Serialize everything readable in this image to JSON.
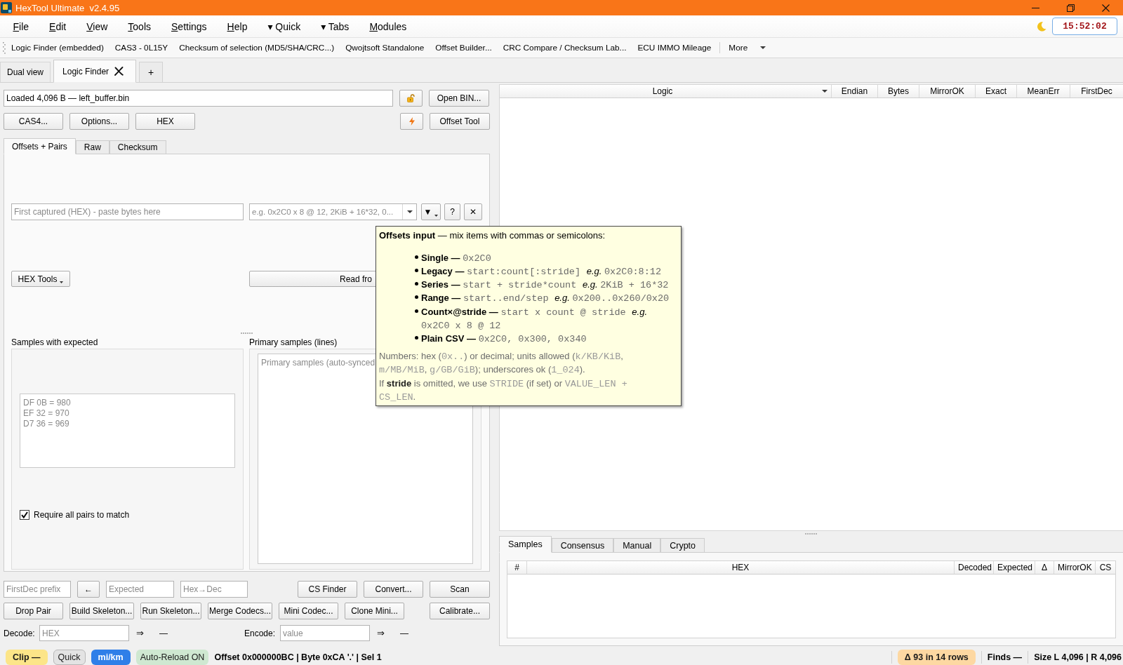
{
  "window": {
    "title": "HexTool Ultimate  v2.4.95"
  },
  "menu": [
    {
      "label": "File",
      "mnemonic": true
    },
    {
      "label": "Edit",
      "mnemonic": true
    },
    {
      "label": "View",
      "mnemonic": true
    },
    {
      "label": "Tools",
      "mnemonic": true
    },
    {
      "label": "Settings",
      "mnemonic": true
    },
    {
      "label": "Help",
      "mnemonic": true
    },
    {
      "label": "▾ Quick",
      "mnemonic": false
    },
    {
      "label": "▾ Tabs",
      "mnemonic": false
    },
    {
      "label": "Modules",
      "mnemonic": true
    }
  ],
  "clock": "15:52:02",
  "toolbar": {
    "items": [
      "Logic Finder (embedded)",
      "CAS3 - 0L15Y",
      "Checksum of selection (MD5/SHA/CRC...)",
      "Qwojtsoft Standalone",
      "Offset Builder...",
      "CRC Compare / Checksum Lab...",
      "ECU IMMO Mileage"
    ],
    "more": "More"
  },
  "doc_tabs": [
    {
      "label": "Dual view",
      "selected": false,
      "closable": false
    },
    {
      "label": "Logic Finder",
      "selected": true,
      "closable": true
    }
  ],
  "new_tab": "+",
  "logic_finder": {
    "file_field": {
      "value": "Loaded 4,096 B — left_buffer.bin"
    },
    "open_button": "Open BIN...",
    "tool_buttons": [
      "CAS4...",
      "Options...",
      "HEX"
    ],
    "offset_tool_button": "Offset Tool",
    "tabs": [
      {
        "label": "Offsets + Pairs",
        "selected": true
      },
      {
        "label": "Raw",
        "selected": false
      },
      {
        "label": "Checksum",
        "selected": false
      }
    ],
    "captured_field": {
      "placeholder": "First captured (HEX) - paste bytes here"
    },
    "offsets_combo": {
      "placeholder": "e.g. 0x2C0 x 8 @ 12, 2KiB + 16*32, 0..."
    },
    "offset_buttons": [
      {
        "label": "▼",
        "kind": "menu"
      },
      {
        "label": "?",
        "kind": "plain"
      },
      {
        "label": "✕",
        "kind": "plain"
      }
    ],
    "hex_tools_button": {
      "label": "HEX Tools",
      "kind": "menu"
    },
    "read_button": "Read fro",
    "samples_label": "Samples with expected",
    "primary_label": "Primary samples (lines)",
    "samples_box": {
      "placeholder": "DF 0B = 980\nEF 32 = 970\nD7 36 = 969"
    },
    "require_all_pairs": {
      "label": "Require all pairs to match",
      "checked": true
    },
    "primary_box": {
      "placeholder": "Primary samples (auto-synced"
    },
    "lookup_row": {
      "left": [
        {
          "kind": "field",
          "placeholder": "FirstDec prefix"
        },
        {
          "kind": "button",
          "label": "←"
        },
        {
          "kind": "field",
          "placeholder": "Expected"
        },
        {
          "kind": "field",
          "placeholder": "Hex→Dec"
        }
      ],
      "right": [
        "CS Finder",
        "Convert...",
        "Scan"
      ]
    },
    "action_row": {
      "left": [
        "Drop Pair",
        "Build Skeleton...",
        "Run Skeleton...",
        "Merge Codecs...",
        "Mini Codec...",
        "Clone Mini..."
      ],
      "right": [
        "Calibrate..."
      ]
    },
    "codec_row": [
      {
        "label": "Decode:",
        "placeholder": "HEX",
        "arrow": "⇒",
        "result": "—"
      },
      {
        "label": "Encode:",
        "placeholder": "value",
        "arrow": "⇒",
        "result": "—"
      }
    ]
  },
  "results_table": {
    "columns": [
      {
        "label": "Logic",
        "sorted": true
      },
      {
        "label": "Endian",
        "sorted": false
      },
      {
        "label": "Bytes",
        "sorted": false
      },
      {
        "label": "MirrorOK",
        "sorted": false
      },
      {
        "label": "Exact",
        "sorted": false
      },
      {
        "label": "MeanErr",
        "sorted": false
      },
      {
        "label": "FirstDec",
        "sorted": false
      }
    ]
  },
  "lower_tabs": [
    {
      "label": "Samples",
      "selected": true
    },
    {
      "label": "Consensus",
      "selected": false
    },
    {
      "label": "Manual",
      "selected": false
    },
    {
      "label": "Crypto",
      "selected": false
    }
  ],
  "samples_table": {
    "columns": [
      "#",
      "HEX",
      "Decoded",
      "Expected",
      "Δ",
      "MirrorOK",
      "CS"
    ]
  },
  "tooltip": {
    "title": "**Offsets input** — mix items with commas or semicolons:",
    "items": [
      {
        "label": "Single —",
        "syntax": "0x2C0"
      },
      {
        "label": "Legacy —",
        "syntax": "start:count[:stride]",
        "eg": "e.g.",
        "example": "0x2C0:8:12"
      },
      {
        "label": "Series —",
        "syntax": "start + stride*count",
        "eg": "e.g.",
        "example": "2KiB + 16*32"
      },
      {
        "label": "Range —",
        "syntax": "start..end/step",
        "eg": "e.g.",
        "example": "0x200..0x260/0x20"
      },
      {
        "label": "Count×@stride —",
        "syntax": "start x count @ stride",
        "eg": "e.g.",
        "example": "0x2C0 x 8 @ 12"
      },
      {
        "label": "Plain CSV —",
        "syntax": "0x2C0, 0x300, 0x340"
      }
    ],
    "notes": [
      [
        {
          "kind": "text",
          "text": "Numbers: hex ("
        },
        {
          "kind": "code",
          "text": "0x.."
        },
        {
          "kind": "text",
          "text": ") or decimal; units allowed ("
        },
        {
          "kind": "code",
          "text": "k/KB/KiB"
        },
        {
          "kind": "text",
          "text": ", "
        },
        {
          "kind": "code",
          "text": "m/MB/MiB"
        },
        {
          "kind": "text",
          "text": ", "
        },
        {
          "kind": "code",
          "text": "g/GB/GiB"
        },
        {
          "kind": "text",
          "text": "); underscores ok ("
        },
        {
          "kind": "code",
          "text": "1_024"
        },
        {
          "kind": "text",
          "text": ")."
        }
      ],
      [
        {
          "kind": "text",
          "text": "If **stride** is omitted, we use "
        },
        {
          "kind": "code",
          "text": "STRIDE"
        },
        {
          "kind": "text",
          "text": " (if set) or "
        },
        {
          "kind": "code",
          "text": "VALUE_LEN + CS_LEN"
        },
        {
          "kind": "text",
          "text": "."
        }
      ]
    ]
  },
  "status_bar": {
    "left": [
      {
        "text": "Clip —",
        "kind": "badge",
        "color": "#fce588"
      },
      {
        "text": "Quick",
        "kind": "button",
        "color": "#e3e3e3"
      },
      {
        "text": "mi/km",
        "kind": "badge",
        "color": "#2f7fe8"
      },
      {
        "text": "Auto-Reload ON",
        "kind": "flag",
        "color": "#cfe8d1"
      },
      {
        "text": "Offset 0x000000BC | Byte 0xCA '.' | Sel 1",
        "kind": "text"
      }
    ],
    "right": [
      {
        "text": "Δ 93 in 14 rows",
        "kind": "badge",
        "color": "#fdd8a2"
      },
      {
        "text": "Finds —",
        "kind": "text"
      },
      {
        "text": "Size L 4,096 | R 4,096",
        "kind": "text"
      }
    ]
  }
}
